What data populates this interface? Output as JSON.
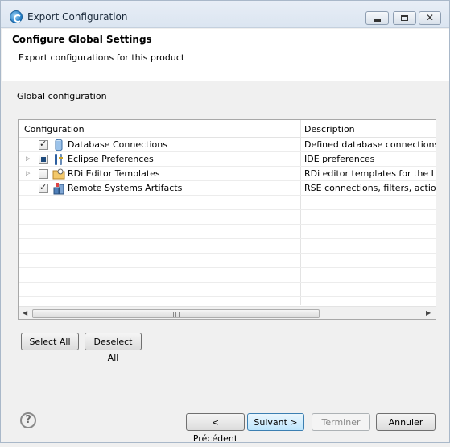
{
  "window": {
    "title": "Export Configuration",
    "close_glyph": "✕"
  },
  "header": {
    "title": "Configure Global Settings",
    "description": "Export configurations for this product"
  },
  "section_label": "Global configuration",
  "table": {
    "columns": [
      "Configuration",
      "Description"
    ],
    "rows": [
      {
        "label": "Database Connections",
        "description": "Defined database connections",
        "checked": "checked",
        "expandable": false,
        "icon": "database-icon"
      },
      {
        "label": "Eclipse Preferences",
        "description": "IDE preferences",
        "checked": "partial",
        "expandable": true,
        "icon": "preferences-tools-icon"
      },
      {
        "label": "RDi Editor Templates",
        "description": "RDi editor templates for the LP",
        "checked": "unchecked",
        "expandable": true,
        "icon": "folder-templates-icon"
      },
      {
        "label": "Remote Systems Artifacts",
        "description": "RSE connections, filters, action",
        "checked": "checked",
        "expandable": false,
        "icon": "remote-systems-icon"
      }
    ]
  },
  "buttons": {
    "select_all": "Select All",
    "deselect_all": "Deselect All",
    "back": "< Précédent",
    "next": "Suivant >",
    "finish": "Terminer",
    "cancel": "Annuler"
  },
  "help_glyph": "?",
  "colors": {
    "accent": "#3c7fb1",
    "header_bg": "#ffffff",
    "dialog_bg": "#f0f0f0"
  }
}
